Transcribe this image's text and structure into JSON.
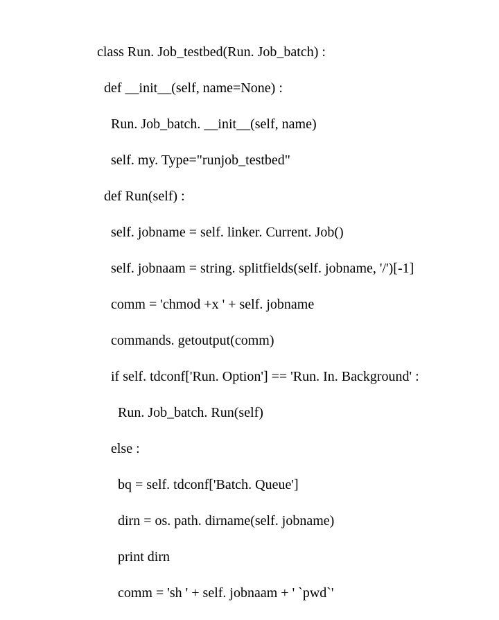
{
  "code": {
    "lines": [
      "class Run. Job_testbed(Run. Job_batch) :",
      "  def __init__(self, name=None) :",
      "    Run. Job_batch. __init__(self, name)",
      "    self. my. Type=\"runjob_testbed\"",
      "  def Run(self) :",
      "    self. jobname = self. linker. Current. Job()",
      "    self. jobnaam = string. splitfields(self. jobname, '/')[-1]",
      "    comm = 'chmod +x ' + self. jobname",
      "    commands. getoutput(comm)",
      "    if self. tdconf['Run. Option'] == 'Run. In. Background' :",
      "      Run. Job_batch. Run(self)",
      "    else :",
      "      bq = self. tdconf['Batch. Queue']",
      "      dirn = os. path. dirname(self. jobname)",
      "      print dirn",
      "      comm = 'sh ' + self. jobnaam + ' `pwd`'"
    ]
  }
}
